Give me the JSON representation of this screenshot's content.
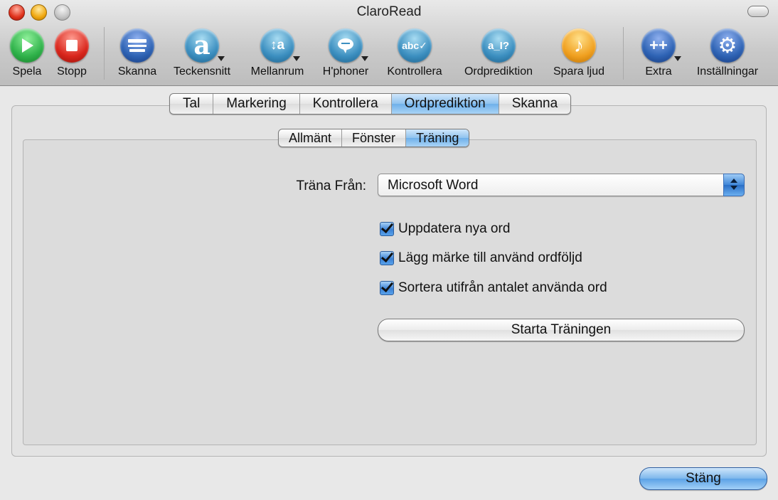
{
  "window": {
    "title": "ClaroRead"
  },
  "toolbar": {
    "items": [
      {
        "label": "Spela",
        "icon": "play-icon"
      },
      {
        "label": "Stopp",
        "icon": "stop-icon"
      },
      {
        "label": "Skanna",
        "icon": "scanner-icon"
      },
      {
        "label": "Teckensnitt",
        "icon": "font-icon",
        "glyph": "a"
      },
      {
        "label": "Mellanrum",
        "icon": "spacing-icon",
        "glyph": "↕a"
      },
      {
        "label": "H'phoner",
        "icon": "speech-bubble-icon"
      },
      {
        "label": "Kontrollera",
        "icon": "spellcheck-icon",
        "glyph": "abc✓"
      },
      {
        "label": "Ordprediktion",
        "icon": "word-prediction-icon",
        "glyph": "a_I?"
      },
      {
        "label": "Spara ljud",
        "icon": "save-audio-icon",
        "glyph": "♪"
      },
      {
        "label": "Extra",
        "icon": "extra-plus-icon",
        "glyph": "++"
      },
      {
        "label": "Inställningar",
        "icon": "gear-icon",
        "glyph": "⚙"
      }
    ]
  },
  "main_tabs": [
    "Tal",
    "Markering",
    "Kontrollera",
    "Ordprediktion",
    "Skanna"
  ],
  "main_tabs_active": "Ordprediktion",
  "sub_tabs": [
    "Allmänt",
    "Fönster",
    "Träning"
  ],
  "sub_tabs_active": "Träning",
  "training": {
    "source_label": "Träna Från:",
    "source_value": "Microsoft Word",
    "checkboxes": [
      {
        "label": "Uppdatera nya ord",
        "checked": true
      },
      {
        "label": "Lägg märke till använd ordföljd",
        "checked": true
      },
      {
        "label": "Sortera utifrån antalet använda ord",
        "checked": true
      }
    ],
    "start_button": "Starta Träningen"
  },
  "close_button": "Stäng",
  "colors": {
    "play": "#2fb24a",
    "stop": "#d9261c",
    "blue": "#2e63b4",
    "teal": "#3c8fc0",
    "orange": "#f0a020",
    "accent": "#6fb0ea"
  }
}
